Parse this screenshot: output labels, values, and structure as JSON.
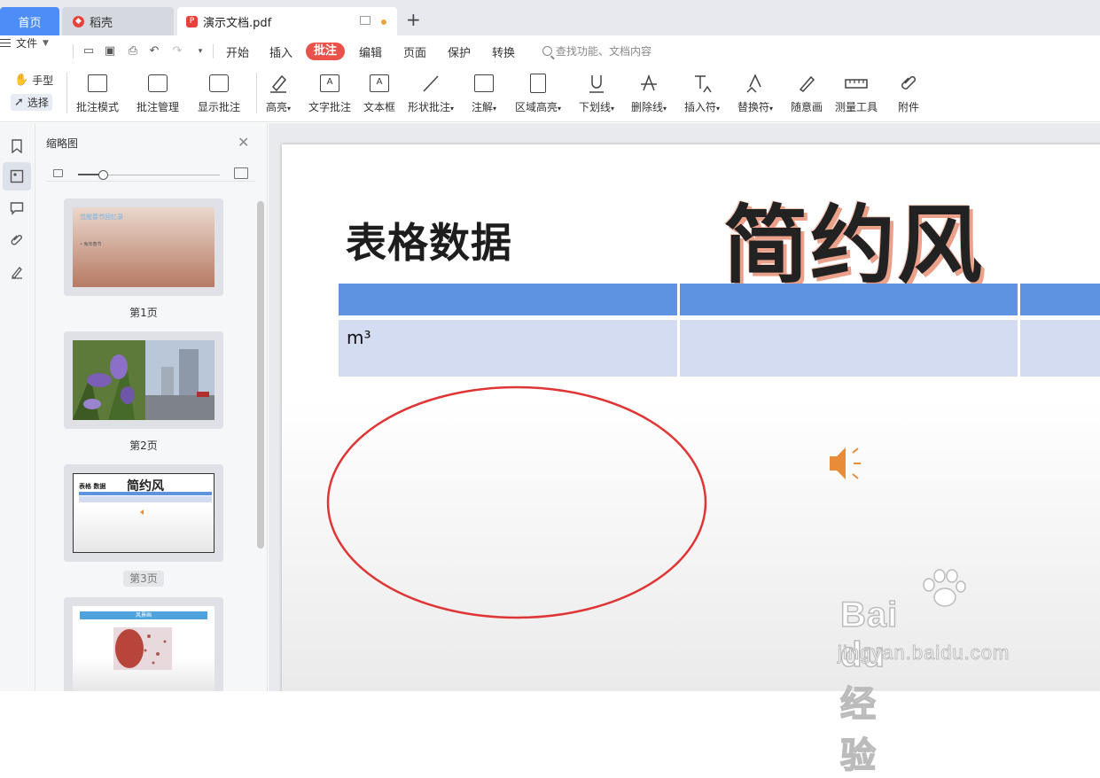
{
  "tabs": {
    "home": "首页",
    "daoke": "稻壳",
    "document": "演示文档.pdf"
  },
  "menu": {
    "file": "文件",
    "items": [
      "开始",
      "插入",
      "批注",
      "编辑",
      "页面",
      "保护",
      "转换"
    ],
    "active": "批注",
    "search_placeholder": "查找功能、文档内容"
  },
  "toolbar": {
    "hand": "手型",
    "select": "选择",
    "buttons": [
      "批注模式",
      "批注管理",
      "显示批注",
      "高亮",
      "文字批注",
      "文本框",
      "形状批注",
      "注解",
      "区域高亮",
      "下划线",
      "删除线",
      "插入符",
      "替换符",
      "随意画",
      "测量工具",
      "附件"
    ]
  },
  "panel": {
    "title": "缩略图",
    "zoom_level": 0.18,
    "pages": [
      "第1页",
      "第2页",
      "第3页"
    ],
    "current_page": 3,
    "thumb1_title": "觉醒春节回忆录",
    "thumb1_bullet": "• 兔年春节",
    "thumb3_title": "表格 数据",
    "thumb3_big": "简约风",
    "thumb4_title": "风景画"
  },
  "slide": {
    "title": "表格数据",
    "big_text": "简约风",
    "cell_text": "m³"
  },
  "watermark": {
    "brand": "Bai du 经验",
    "url": "jingyan.baidu.com"
  },
  "colors": {
    "accent_blue": "#4d8df7",
    "annotation_red": "#e8524a",
    "table_header": "#5e93e1",
    "table_row": "#d3dcf1",
    "ellipse": "#e03535",
    "speaker": "#e98c3a"
  }
}
